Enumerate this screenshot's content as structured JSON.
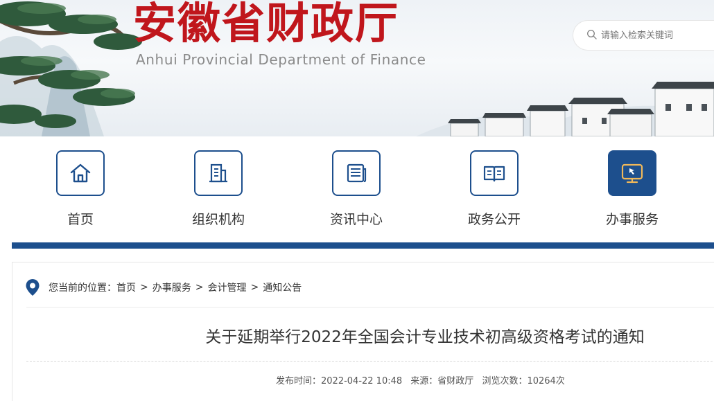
{
  "header": {
    "title_cn": "安徽省财政厅",
    "title_en": "Anhui Provincial Department of Finance",
    "search_placeholder": "请输入检索关键词"
  },
  "nav": {
    "items": [
      {
        "label": "首页",
        "icon": "home-icon"
      },
      {
        "label": "组织机构",
        "icon": "building-icon"
      },
      {
        "label": "资讯中心",
        "icon": "news-icon"
      },
      {
        "label": "政务公开",
        "icon": "open-book-icon"
      },
      {
        "label": "办事服务",
        "icon": "service-monitor-icon",
        "active": true
      }
    ],
    "accent": "#1d4f8d"
  },
  "breadcrumb": {
    "prefix": "您当前的位置：",
    "items": [
      "首页",
      "办事服务",
      "会计管理",
      "通知公告"
    ],
    "separator": ">"
  },
  "article": {
    "title": "关于延期举行2022年全国会计专业技术初高级资格考试的通知",
    "publish_time": "发布时间：2022-04-22 10:48",
    "source": "来源：省财政厅",
    "views": "浏览次数：10264次"
  }
}
